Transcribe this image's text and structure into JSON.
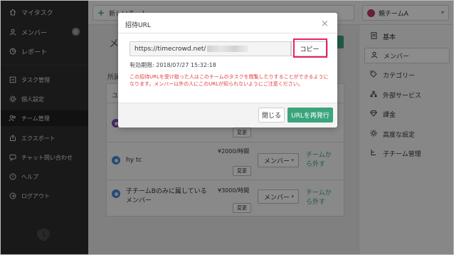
{
  "sidebar": {
    "items": [
      {
        "label": "マイタスク",
        "icon": "home-icon"
      },
      {
        "label": "メンバー",
        "icon": "user-icon",
        "badge": "0"
      },
      {
        "label": "レポート",
        "icon": "report-icon"
      },
      {
        "label": "タスク管理",
        "icon": "folder-icon"
      },
      {
        "label": "個人設定",
        "icon": "gear-icon"
      },
      {
        "label": "チーム管理",
        "icon": "team-icon"
      },
      {
        "label": "エクスポート",
        "icon": "export-icon"
      },
      {
        "label": "チャット問い合わせ",
        "icon": "chat-icon"
      },
      {
        "label": "ヘルプ",
        "icon": "help-icon"
      },
      {
        "label": "ログアウト",
        "icon": "logout-icon"
      }
    ]
  },
  "topbar": {
    "new_task_label": "新しいチーム",
    "team_name": "親チームA"
  },
  "main": {
    "title": "メ",
    "section_label": "所属",
    "table_header": "ユ",
    "rows": [
      {
        "name": "",
        "rate": "",
        "change_label": "変更"
      },
      {
        "name": "hy tc",
        "rate": "¥2000/時間",
        "change_label": "変更",
        "role": "メンバー",
        "remove": "チームから外す"
      },
      {
        "name": "子チームBのみに属しているメンバー",
        "rate": "¥3000/時間",
        "change_label": "変更",
        "role": "メンバー",
        "remove": "チームから外す"
      }
    ]
  },
  "right_panel": {
    "items": [
      {
        "label": "基本",
        "icon": "document-icon"
      },
      {
        "label": "メンバー",
        "icon": "user-icon",
        "active": true
      },
      {
        "label": "カテゴリー",
        "icon": "tag-icon"
      },
      {
        "label": "外部サービス",
        "icon": "network-icon"
      },
      {
        "label": "課金",
        "icon": "diamond-icon"
      },
      {
        "label": "高度な設定",
        "icon": "gear-icon"
      },
      {
        "label": "子チーム管理",
        "icon": "tree-icon"
      }
    ]
  },
  "modal": {
    "title": "招待URL",
    "url_value": "https://timecrowd.net/",
    "copy_label": "コピー",
    "expiry": "有効期限: 2018/07/27 15:32:18",
    "warning": "この招待URLを受け取った人はこのチームのタスクを閲覧したりすることができるようになります。メンバー以外の人にこのURLが知られないようにご注意ください。",
    "close_label": "閉じる",
    "reissue_label": "URLを再発行"
  },
  "colors": {
    "accent_green": "#3aa57d",
    "highlight_pink": "#e5236d",
    "warning_red": "#e23b3b",
    "sidebar_bg": "#2f2f2f"
  }
}
